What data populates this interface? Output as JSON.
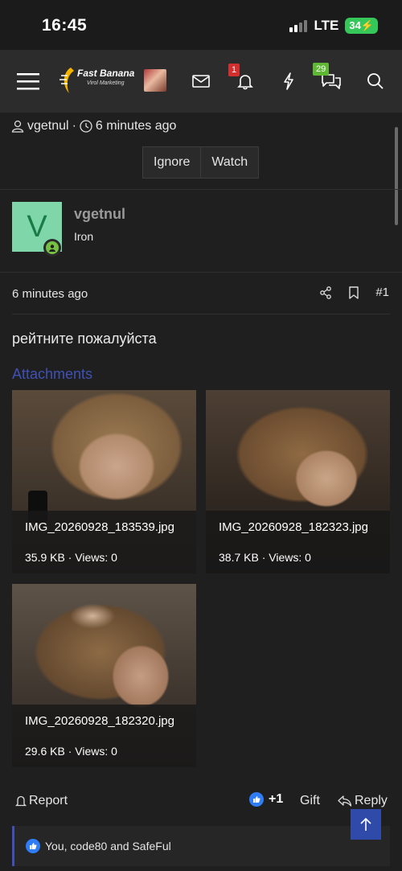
{
  "status_bar": {
    "time": "16:45",
    "network": "LTE",
    "battery": "34"
  },
  "navbar": {
    "logo_text": "Fast Banana",
    "logo_subtext": "Virol Marketing",
    "alerts_count": "1",
    "conversations_count": "29",
    "icons": [
      "menu-icon",
      "mail-icon",
      "bell-icon",
      "lightning-icon",
      "chat-icon",
      "search-icon"
    ]
  },
  "thread": {
    "author": "vgetnul",
    "separator": "·",
    "time": "6 minutes ago",
    "ignore_label": "Ignore",
    "watch_label": "Watch"
  },
  "post": {
    "avatar_letter": "V",
    "username": "vgetnul",
    "user_title": "Iron",
    "time": "6 minutes ago",
    "number": "#1",
    "body": "рейтните пожалуйста",
    "attachments_title": "Attachments",
    "attachments": [
      {
        "name": "IMG_20260928_183539.jpg",
        "meta": "35.9 KB · Views: 0"
      },
      {
        "name": "IMG_20260928_182323.jpg",
        "meta": "38.7 KB · Views: 0"
      },
      {
        "name": "IMG_20260928_182320.jpg",
        "meta": "29.6 KB · Views: 0"
      }
    ],
    "report_label": "Report",
    "reaction_count": "+1",
    "gift_label": "Gift",
    "reply_label": "Reply",
    "likes_text": "You, code80 and SafeFul"
  },
  "colors": {
    "accent": "#3f51b5",
    "like_blue": "#2f7df6",
    "online_green": "#76c043",
    "alert_red": "#d32f2f",
    "convo_green": "#5fb833",
    "avatar_bg": "#7fd7a9"
  }
}
